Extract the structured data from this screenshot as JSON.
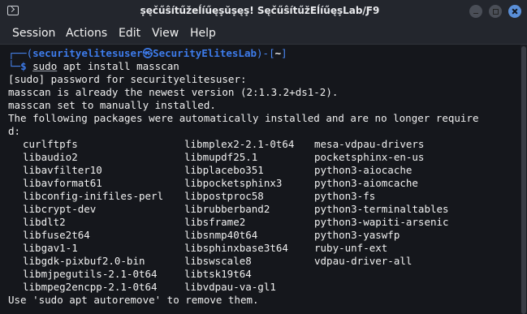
{
  "window": {
    "title": "ṣęčűŝítűžeĺíűęṣŭṣęṣ! SęčűŝítűžEĺíűęṣLab/Ƒ9"
  },
  "menu": {
    "items": [
      "Session",
      "Actions",
      "Edit",
      "View",
      "Help"
    ]
  },
  "prompt": {
    "line1_prefix": "┌──(",
    "user_host": "securityelitesuser㉿SecurityElitesLab",
    "mid": ")-[",
    "dir": "~",
    "end": "]",
    "line2_prefix": "└─",
    "dollar": "$",
    "cmd_sudo": "sudo",
    "cmd_rest": " apt install masscan"
  },
  "output": {
    "l1": "[sudo] password for securityelitesuser:",
    "l2": "masscan is already the newest version (2:1.3.2+ds1-2).",
    "l3": "masscan set to manually installed.",
    "l4": "The following packages were automatically installed and are no longer require",
    "l5": "d:",
    "footer": "Use 'sudo apt autoremove' to remove them."
  },
  "packages": {
    "col1": [
      "curlftpfs",
      "libaudio2",
      "libavfilter10",
      "libavformat61",
      "libconfig-inifiles-perl",
      "libcrypt-dev",
      "libdlt2",
      "libfuse2t64",
      "libgav1-1",
      "libgdk-pixbuf2.0-bin",
      "libmjpegutils-2.1-0t64",
      "libmpeg2encpp-2.1-0t64"
    ],
    "col2": [
      "libmplex2-2.1-0t64",
      "libmupdf25.1",
      "libplacebo351",
      "libpocketsphinx3",
      "libpostproc58",
      "librubberband2",
      "libsframe2",
      "libsnmp40t64",
      "libsphinxbase3t64",
      "libswscale8",
      "libtsk19t64",
      "libvdpau-va-gl1"
    ],
    "col3": [
      "mesa-vdpau-drivers",
      "pocketsphinx-en-us",
      "python3-aiocache",
      "python3-aiomcache",
      "python3-fs",
      "python3-terminaltables",
      "python3-wapiti-arsenic",
      "python3-yaswfp",
      "ruby-unf-ext",
      "vdpau-driver-all"
    ]
  },
  "icons": {
    "app": "terminal-icon",
    "minimize": "minimize-icon",
    "maximize": "maximize-icon",
    "close": "close-icon"
  },
  "colors": {
    "prompt": "#3d7bea",
    "background": "#15171c",
    "close_button": "#5a8fd8"
  }
}
